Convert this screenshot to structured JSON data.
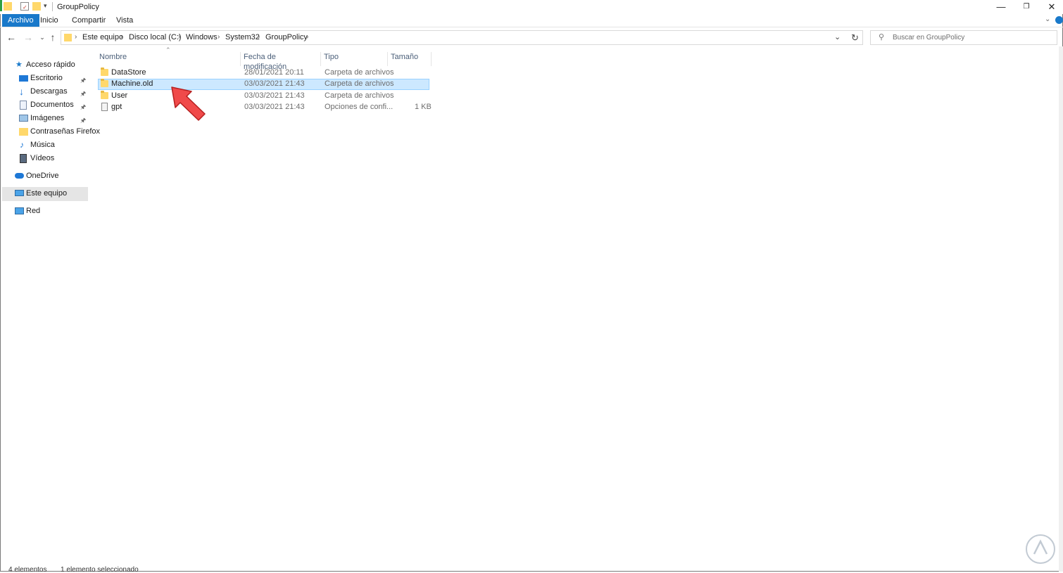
{
  "window": {
    "title": "GroupPolicy",
    "controls": [
      "minimize-icon",
      "restore-icon",
      "close-icon"
    ]
  },
  "ribbon": {
    "tabs": [
      "Archivo",
      "Inicio",
      "Compartir",
      "Vista"
    ],
    "active": "Archivo"
  },
  "address": {
    "breadcrumb": [
      "Este equipo",
      "Disco local (C:)",
      "Windows",
      "System32",
      "GroupPolicy"
    ]
  },
  "search": {
    "placeholder": "Buscar en GroupPolicy"
  },
  "sidebar": {
    "quick_access": "Acceso rápido",
    "items": [
      {
        "label": "Escritorio",
        "icon": "desktop-icon",
        "pinned": true
      },
      {
        "label": "Descargas",
        "icon": "download-icon",
        "pinned": true
      },
      {
        "label": "Documentos",
        "icon": "documents-icon",
        "pinned": true
      },
      {
        "label": "Imágenes",
        "icon": "pictures-icon",
        "pinned": true
      },
      {
        "label": "Contraseñas Firefox",
        "icon": "folder-icon",
        "pinned": false
      },
      {
        "label": "Música",
        "icon": "music-icon",
        "pinned": false
      },
      {
        "label": "Vídeos",
        "icon": "videos-icon",
        "pinned": false
      }
    ],
    "onedrive": "OneDrive",
    "this_pc": "Este equipo",
    "network": "Red"
  },
  "columns": [
    "Nombre",
    "Fecha de modificación",
    "Tipo",
    "Tamaño"
  ],
  "files": [
    {
      "name": "DataStore",
      "date": "28/01/2021 20:11",
      "type": "Carpeta de archivos",
      "size": "",
      "icon": "folder-icon"
    },
    {
      "name": "Machine.old",
      "date": "03/03/2021 21:43",
      "type": "Carpeta de archivos",
      "size": "",
      "icon": "folder-icon",
      "selected": true
    },
    {
      "name": "User",
      "date": "03/03/2021 21:43",
      "type": "Carpeta de archivos",
      "size": "",
      "icon": "folder-icon"
    },
    {
      "name": "gpt",
      "date": "03/03/2021 21:43",
      "type": "Opciones de confi...",
      "size": "1 KB",
      "icon": "settings-file-icon"
    }
  ],
  "status": {
    "count": "4 elementos",
    "selection": "1 elemento seleccionado"
  },
  "colors": {
    "accent": "#1979ca",
    "selection_bg": "#cce8ff",
    "selection_border": "#99d1ff",
    "annotation_arrow": "#f04a4a"
  }
}
